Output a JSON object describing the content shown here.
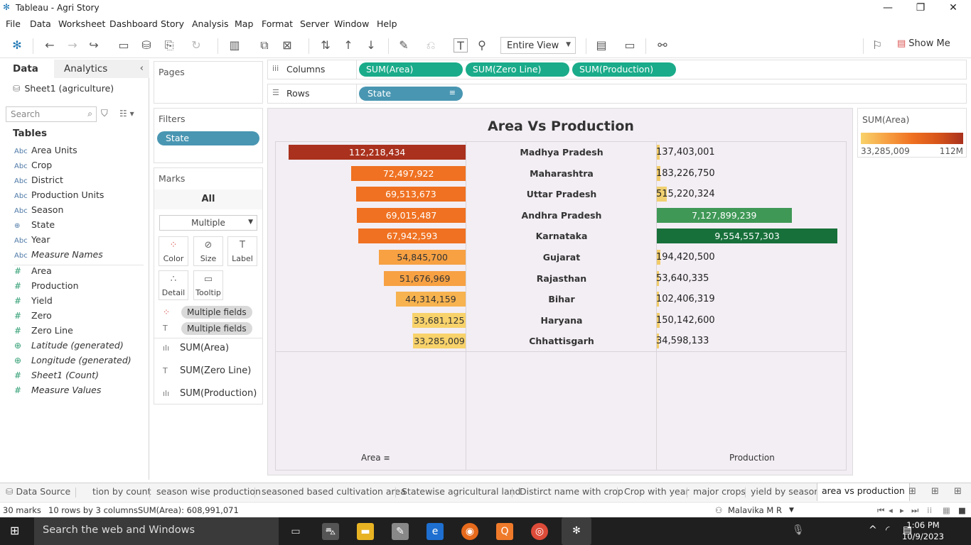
{
  "window": {
    "title": "Tableau - Agri Story"
  },
  "menu": [
    "File",
    "Data",
    "Worksheet",
    "Dashboard",
    "Story",
    "Analysis",
    "Map",
    "Format",
    "Server",
    "Window",
    "Help"
  ],
  "toolbar": {
    "fit": "Entire View",
    "show_me": "Show Me"
  },
  "datapane": {
    "tab_data": "Data",
    "tab_analytics": "Analytics",
    "datasource": "Sheet1 (agriculture)",
    "search_placeholder": "Search",
    "tables_header": "Tables",
    "dimensions": [
      {
        "type": "Abc",
        "name": "Area Units"
      },
      {
        "type": "Abc",
        "name": "Crop"
      },
      {
        "type": "Abc",
        "name": "District"
      },
      {
        "type": "Abc",
        "name": "Production Units"
      },
      {
        "type": "Abc",
        "name": "Season"
      },
      {
        "type": "globe",
        "name": "State"
      },
      {
        "type": "Abc",
        "name": "Year"
      },
      {
        "type": "Abc",
        "name": "Measure Names"
      }
    ],
    "measures": [
      {
        "type": "#",
        "name": "Area"
      },
      {
        "type": "#",
        "name": "Production"
      },
      {
        "type": "#",
        "name": "Yield"
      },
      {
        "type": "#",
        "name": "Zero"
      },
      {
        "type": "#",
        "name": "Zero Line"
      },
      {
        "type": "globe",
        "name": "Latitude (generated)"
      },
      {
        "type": "globe",
        "name": "Longitude (generated)"
      },
      {
        "type": "#",
        "name": "Sheet1 (Count)"
      },
      {
        "type": "#",
        "name": "Measure Values"
      }
    ]
  },
  "cards": {
    "pages": "Pages",
    "filters": "Filters",
    "filter_pill": "State",
    "marks": "Marks",
    "marks_all": "All",
    "mark_type": "Multiple",
    "buttons": [
      "Color",
      "Size",
      "Label",
      "Detail",
      "Tooltip"
    ],
    "mark_pills": [
      "Multiple fields",
      "Multiple fields"
    ],
    "mark_measures": [
      "SUM(Area)",
      "SUM(Zero Line)",
      "SUM(Production)"
    ]
  },
  "shelves": {
    "columns_label": "Columns",
    "columns": [
      "SUM(Area)",
      "SUM(Zero Line)",
      "SUM(Production)"
    ],
    "rows_label": "Rows",
    "rows": [
      "State"
    ]
  },
  "viz": {
    "title": "Area Vs Production",
    "area_axis": "Area",
    "production_axis": "Production"
  },
  "chart_data": {
    "type": "bar",
    "title": "Area Vs Production",
    "categories": [
      "Madhya Pradesh",
      "Maharashtra",
      "Uttar Pradesh",
      "Andhra Pradesh",
      "Karnataka",
      "Gujarat",
      "Rajasthan",
      "Bihar",
      "Haryana",
      "Chhattisgarh"
    ],
    "series": [
      {
        "name": "Area",
        "values": [
          112218434,
          72497922,
          69513673,
          69015487,
          67942593,
          54845700,
          51676969,
          44314159,
          33681125,
          33285009
        ],
        "labels": [
          "112,218,434",
          "72,497,922",
          "69,513,673",
          "69,015,487",
          "67,942,593",
          "54,845,700",
          "51,676,969",
          "44,314,159",
          "33,681,125",
          "33,285,009"
        ]
      },
      {
        "name": "Production",
        "values": [
          137403001,
          183226750,
          515220324,
          7127899239,
          9554557303,
          194420500,
          53640335,
          102406319,
          150142600,
          34598133
        ],
        "labels": [
          "137,403,001",
          "183,226,750",
          "515,220,324",
          "7,127,899,239",
          "9,554,557,303",
          "194,420,500",
          "53,640,335",
          "102,406,319",
          "150,142,600",
          "34,598,133"
        ]
      }
    ],
    "xlabel_left": "Area",
    "xlabel_right": "Production",
    "area_colors": [
      "#a9311d",
      "#ef7121",
      "#ef7121",
      "#ef7121",
      "#ef7121",
      "#f7a143",
      "#f7a143",
      "#f7b34f",
      "#f8d26a",
      "#f8d26a"
    ],
    "production_colors": [
      "#f2cc6a",
      "#f2cc6a",
      "#f0d070",
      "#3f9856",
      "#17703a",
      "#f2cc6a",
      "#f2cc6a",
      "#f2cc6a",
      "#f2cc6a",
      "#f2cc6a"
    ]
  },
  "legend": {
    "title": "SUM(Area)",
    "min": "33,285,009",
    "max": "112M"
  },
  "sheet_tabs": [
    "Data Source",
    "tion by count",
    "season wise production",
    "seasoned based cultivation area",
    "Statewise agricultural land",
    "Distirct name with crop",
    "Crop with year",
    "major crops",
    "yield by season",
    "area vs production"
  ],
  "status": {
    "marks": "30 marks",
    "dims": "10 rows by 3 columns",
    "sum": "SUM(Area): 608,991,071",
    "user": "Malavika  M R"
  },
  "taskbar": {
    "search": "Search the web and Windows",
    "time": "1:06 PM",
    "date": "10/9/2023"
  }
}
